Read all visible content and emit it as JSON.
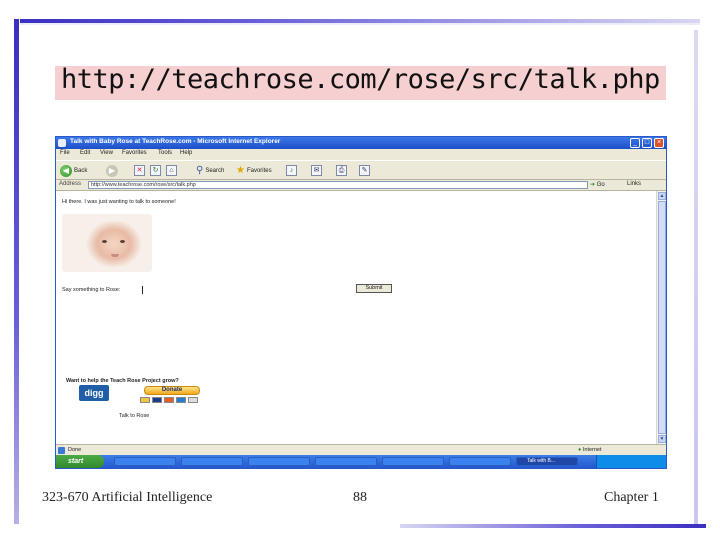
{
  "slide": {
    "title": "http://teachrose.com/rose/src/talk.php",
    "footer_left": "323-670 Artificial Intelligence",
    "footer_center": "88",
    "footer_right": "Chapter 1"
  },
  "browser": {
    "window_title": "Talk with Baby Rose at TeachRose.com - Microsoft Internet Explorer",
    "menu": [
      "File",
      "Edit",
      "View",
      "Favorites",
      "Tools",
      "Help"
    ],
    "toolbar": {
      "back": "Back",
      "search": "Search",
      "favorites": "Favorites"
    },
    "address_label": "Address",
    "address_value": "http://www.teachrose.com/rose/src/talk.php",
    "go_label": "Go",
    "links_label": "Links",
    "status_text": "Done",
    "status_zone": "Internet"
  },
  "page": {
    "greeting": "Hi there. I was just wanting to talk to someone!",
    "say_label": "Say something to Rose:",
    "submit_label": "Submit",
    "help_text": "Want to help the Teach Rose Project grow?",
    "digg_label": "digg",
    "donate_label": "Donate",
    "talk_link": "Talk to Rose"
  },
  "taskbar": {
    "start_label": "start",
    "tasks": [
      "",
      "",
      "",
      "",
      "",
      "",
      "",
      "Talk with B..."
    ],
    "clock": ""
  },
  "colors": {
    "slide_accent": "#3a2fc0",
    "title_highlight": "#f6cfd1",
    "xp_titlebar": "#1d4fc8",
    "xp_start": "#2f8a2b"
  },
  "icons": [
    "back-icon",
    "forward-icon",
    "stop-icon",
    "refresh-icon",
    "home-icon",
    "search-icon",
    "favorites-icon",
    "media-icon",
    "mail-icon",
    "print-icon",
    "edit-icon",
    "go-icon"
  ]
}
